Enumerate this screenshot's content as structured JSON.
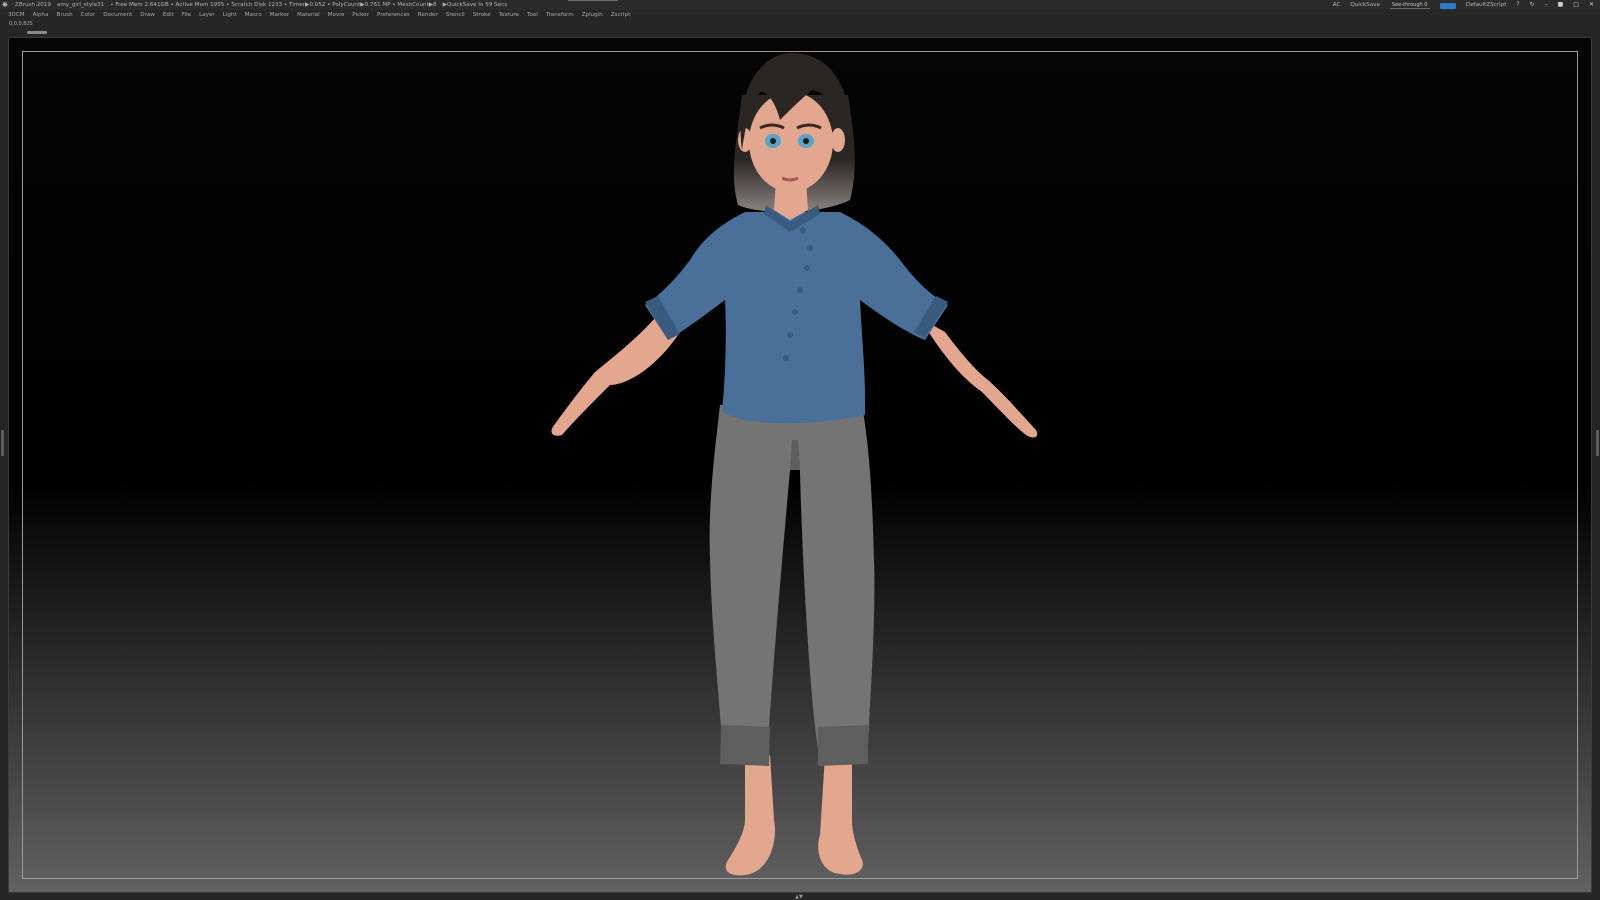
{
  "titlebar": {
    "app_name": "ZBrush 2019",
    "file_name": "amy_girl_style31",
    "stats": "• Free Mem 2.641GB • Active Mem 1955 • Scratch Disk 1233 • Timer▶0.052 • PolyCount▶0.761 MP • MeshCount▶8",
    "quicksave_timer": "▶QuickSave In 59 Secs",
    "ac": "AC",
    "quicksave_label": "QuickSave",
    "see_through_label": "See-through 0",
    "see_through_value": 0,
    "script_label": "DefaultZScript"
  },
  "menu": [
    "3DCM",
    "Alpha",
    "Brush",
    "Color",
    "Document",
    "Draw",
    "Edit",
    "File",
    "Layer",
    "Light",
    "Macro",
    "Marker",
    "Material",
    "Movie",
    "Picker",
    "Preferences",
    "Render",
    "Stencil",
    "Stroke",
    "Texture",
    "Tool",
    "Transform",
    "Zplugin",
    "Zscript"
  ],
  "subbar": {
    "coordinates": "0,0,0,825"
  },
  "colors": {
    "shirt": "#4a7099",
    "shirt_shadow": "#3a5b80",
    "pants": "#747474",
    "pants_shadow": "#5e5e5e",
    "skin": "#e3a68e",
    "hair_dark": "#2a2624",
    "hair_light": "#8a8480",
    "eye": "#5aa3c8",
    "accent_orange": "#d99e2b",
    "accent_blue": "#2a78c8"
  },
  "icons": [
    "zbrush-app-icon",
    "help-icon",
    "rotate-icon",
    "minimize-icon",
    "lock-icon",
    "restore-icon",
    "close-icon"
  ]
}
